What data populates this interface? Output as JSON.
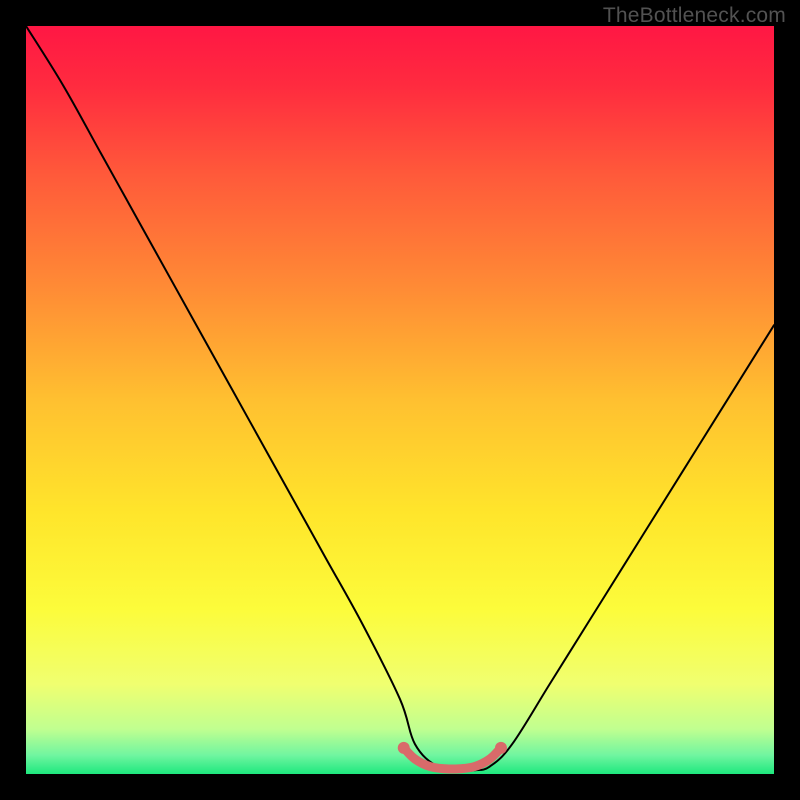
{
  "watermark": "TheBottleneck.com",
  "chart_data": {
    "type": "line",
    "title": "",
    "xlabel": "",
    "ylabel": "",
    "xlim": [
      0,
      100
    ],
    "ylim": [
      0,
      100
    ],
    "grid": false,
    "series": [
      {
        "name": "bottleneck-curve",
        "x": [
          0,
          5,
          10,
          15,
          20,
          25,
          30,
          35,
          40,
          45,
          50,
          52,
          55,
          58,
          60,
          62,
          65,
          70,
          75,
          80,
          85,
          90,
          95,
          100
        ],
        "y": [
          100,
          92,
          83,
          74,
          65,
          56,
          47,
          38,
          29,
          20,
          10,
          4,
          1,
          0.5,
          0.5,
          1,
          4,
          12,
          20,
          28,
          36,
          44,
          52,
          60
        ]
      },
      {
        "name": "highlighted-minimum",
        "x": [
          50.5,
          52,
          54,
          56,
          58,
          60,
          62,
          63.5
        ],
        "y": [
          3.5,
          2,
          1,
          0.7,
          0.7,
          1,
          2,
          3.5
        ]
      }
    ],
    "background_gradient": {
      "stops": [
        {
          "pos": 0.0,
          "color": "#ff1744"
        },
        {
          "pos": 0.08,
          "color": "#ff2b3f"
        },
        {
          "pos": 0.2,
          "color": "#ff5a3a"
        },
        {
          "pos": 0.35,
          "color": "#ff8b35"
        },
        {
          "pos": 0.5,
          "color": "#ffc030"
        },
        {
          "pos": 0.65,
          "color": "#ffe52b"
        },
        {
          "pos": 0.78,
          "color": "#fcfc3b"
        },
        {
          "pos": 0.88,
          "color": "#f0ff70"
        },
        {
          "pos": 0.94,
          "color": "#c0ff90"
        },
        {
          "pos": 0.975,
          "color": "#70f5a0"
        },
        {
          "pos": 1.0,
          "color": "#1ee87e"
        }
      ]
    },
    "highlight_color": "#d96a6a",
    "curve_color": "#000000"
  }
}
